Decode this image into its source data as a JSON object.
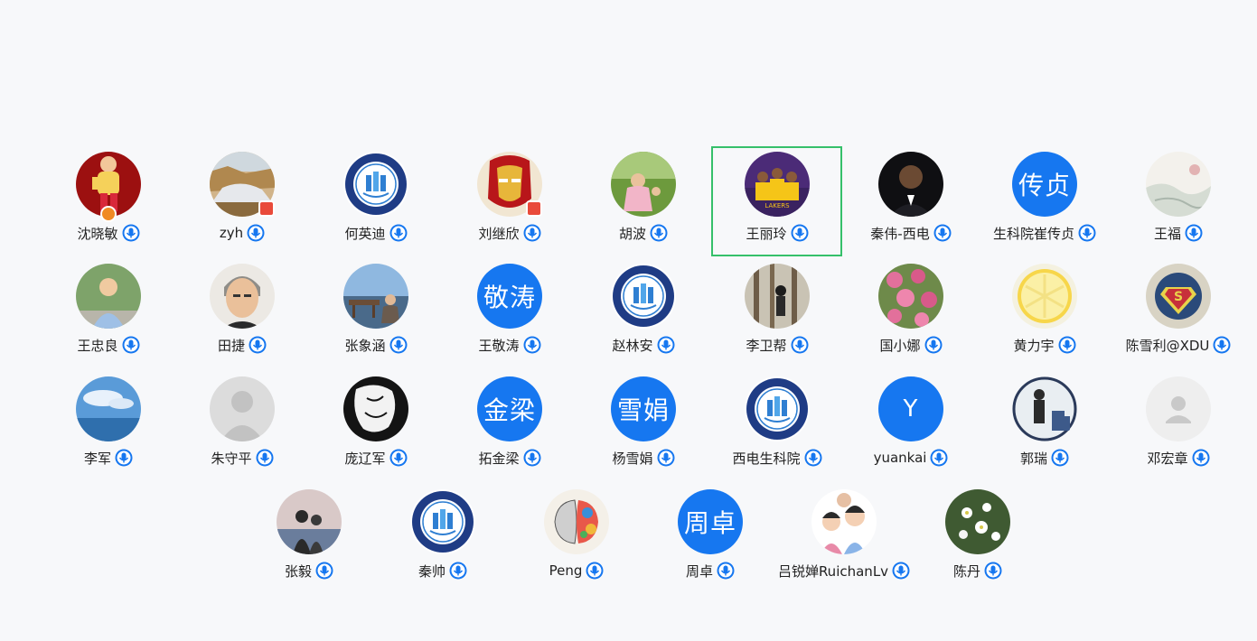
{
  "participants": [
    {
      "name": "沈晓敏",
      "avatar": "photo-child-red"
    },
    {
      "name": "zyh",
      "avatar": "photo-landscape-waterfall"
    },
    {
      "name": "何英迪",
      "avatar": "logo-institute-seal"
    },
    {
      "name": "刘继欣",
      "avatar": "photo-ironman"
    },
    {
      "name": "胡波",
      "avatar": "photo-child-garden"
    },
    {
      "name": "王丽玲",
      "avatar": "photo-basketball-team"
    },
    {
      "name": "秦伟-西电",
      "avatar": "photo-man-suit"
    },
    {
      "name": "生科院崔传贞",
      "avatar_text": "传贞"
    },
    {
      "name": "王福",
      "avatar": "photo-ink-painting"
    },
    {
      "name": "王忠良",
      "avatar": "photo-man-trees"
    },
    {
      "name": "田捷",
      "avatar": "photo-man-portrait"
    },
    {
      "name": "张象涵",
      "avatar": "photo-pier-sea"
    },
    {
      "name": "王敬涛",
      "avatar_text": "敬涛"
    },
    {
      "name": "赵林安",
      "avatar": "logo-institute-seal"
    },
    {
      "name": "李卫帮",
      "avatar": "photo-forest-people"
    },
    {
      "name": "国小娜",
      "avatar": "photo-pink-flowers"
    },
    {
      "name": "黄力宇",
      "avatar": "photo-lemon-slice"
    },
    {
      "name": "陈雪利@XDU",
      "avatar": "logo-superman"
    },
    {
      "name": "李军",
      "avatar": "photo-sky-sea"
    },
    {
      "name": "朱守平",
      "avatar": "default-avatar-grey"
    },
    {
      "name": "庞辽军",
      "avatar": "drawing-black-white"
    },
    {
      "name": "拓金梁",
      "avatar_text": "金梁"
    },
    {
      "name": "杨雪娟",
      "avatar_text": "雪娟"
    },
    {
      "name": "西电生科院",
      "avatar": "logo-institute-seal"
    },
    {
      "name": "yuankai",
      "avatar_text": "Y"
    },
    {
      "name": "郭瑞",
      "avatar": "photo-hiker-city"
    },
    {
      "name": "邓宏章",
      "avatar": "default-avatar-light"
    },
    {
      "name": "张毅",
      "avatar": "photo-couple-sunset"
    },
    {
      "name": "秦帅",
      "avatar": "logo-institute-seal"
    },
    {
      "name": "Peng",
      "avatar": "drawing-colorful-brain"
    },
    {
      "name": "周卓",
      "avatar_text": "周卓"
    },
    {
      "name": "吕锐婵RuichanLv",
      "avatar": "photo-family-kids"
    },
    {
      "name": "陈丹",
      "avatar": "photo-white-flowers"
    }
  ],
  "selected_participant": "王丽玲",
  "colors": {
    "background": "#f7f8fa",
    "accent_blue": "#1677f0",
    "selected_border": "#35c06a",
    "name_text": "#222222"
  }
}
